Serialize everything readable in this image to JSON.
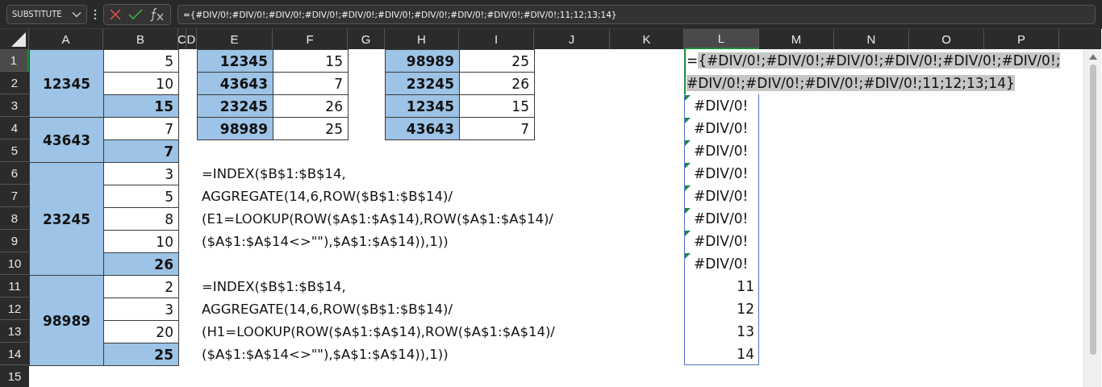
{
  "formula_bar": {
    "name_box": "SUBSTITUTE",
    "formula": "={#DIV/0!;#DIV/0!;#DIV/0!;#DIV/0!;#DIV/0!;#DIV/0!;#DIV/0!;#DIV/0!;#DIV/0!;#DIV/0!;11;12;13;14}"
  },
  "columns": [
    {
      "label": "A",
      "selected": false
    },
    {
      "label": "B",
      "selected": false
    },
    {
      "label": "C",
      "selected": false
    },
    {
      "label": "D",
      "selected": false
    },
    {
      "label": "E",
      "selected": false
    },
    {
      "label": "F",
      "selected": false
    },
    {
      "label": "G",
      "selected": false
    },
    {
      "label": "H",
      "selected": false
    },
    {
      "label": "I",
      "selected": false
    },
    {
      "label": "J",
      "selected": false
    },
    {
      "label": "K",
      "selected": false
    },
    {
      "label": "L",
      "selected": true
    },
    {
      "label": "M",
      "selected": false
    },
    {
      "label": "N",
      "selected": false
    },
    {
      "label": "O",
      "selected": false
    },
    {
      "label": "P",
      "selected": false
    }
  ],
  "rows": [
    {
      "label": "1",
      "selected": true
    },
    {
      "label": "2",
      "selected": false
    },
    {
      "label": "3",
      "selected": false
    },
    {
      "label": "4",
      "selected": false
    },
    {
      "label": "5",
      "selected": false
    },
    {
      "label": "6",
      "selected": false
    },
    {
      "label": "7",
      "selected": false
    },
    {
      "label": "8",
      "selected": false
    },
    {
      "label": "9",
      "selected": false
    },
    {
      "label": "10",
      "selected": false
    },
    {
      "label": "11",
      "selected": false
    },
    {
      "label": "12",
      "selected": false
    },
    {
      "label": "13",
      "selected": false
    },
    {
      "label": "14",
      "selected": false
    },
    {
      "label": "15",
      "selected": false
    }
  ],
  "groups": [
    {
      "label": "12345",
      "values": [
        {
          "value": "5",
          "total": false
        },
        {
          "value": "10",
          "total": false
        },
        {
          "value": "15",
          "total": true
        }
      ]
    },
    {
      "label": "43643",
      "values": [
        {
          "value": "7",
          "total": false
        },
        {
          "value": "7",
          "total": true
        }
      ]
    },
    {
      "label": "23245",
      "values": [
        {
          "value": "3",
          "total": false
        },
        {
          "value": "5",
          "total": false
        },
        {
          "value": "8",
          "total": false
        },
        {
          "value": "10",
          "total": false
        },
        {
          "value": "26",
          "total": true
        }
      ]
    },
    {
      "label": "98989",
      "values": [
        {
          "value": "2",
          "total": false
        },
        {
          "value": "3",
          "total": false
        },
        {
          "value": "20",
          "total": false
        },
        {
          "value": "25",
          "total": true
        }
      ]
    }
  ],
  "lookup_tables": [
    {
      "rows": [
        {
          "key": "12345",
          "value": "15"
        },
        {
          "key": "43643",
          "value": "7"
        },
        {
          "key": "23245",
          "value": "26"
        },
        {
          "key": "98989",
          "value": "25"
        }
      ]
    },
    {
      "rows": [
        {
          "key": "98989",
          "value": "25"
        },
        {
          "key": "23245",
          "value": "26"
        },
        {
          "key": "12345",
          "value": "15"
        },
        {
          "key": "43643",
          "value": "7"
        }
      ]
    }
  ],
  "formulas": [
    {
      "lines": [
        "=INDEX($B$1:$B$14,",
        "AGGREGATE(14,6,ROW($B$1:$B$14)/",
        "(E1=LOOKUP(ROW($A$1:$A$14),ROW($A$1:$A$14)/",
        "($A$1:$A$14<>\"\"),$A$1:$A$14)),1))"
      ]
    },
    {
      "lines": [
        "=INDEX($B$1:$B$14,",
        "AGGREGATE(14,6,ROW($B$1:$B$14)/",
        "(H1=LOOKUP(ROW($A$1:$A$14),ROW($A$1:$A$14)/",
        "($A$1:$A$14<>\"\"),$A$1:$A$14)),1))"
      ]
    }
  ],
  "array_preview": {
    "lines": [
      "={#DIV/0!;#DIV/0!;#DIV/0!;#DIV/0!;#DIV/0!;#DIV/0!;",
      "#DIV/0!;#DIV/0!;#DIV/0!;#DIV/0!;11;12;13;14}"
    ]
  },
  "results": [
    {
      "value": "#DIV/0!",
      "error": true
    },
    {
      "value": "#DIV/0!",
      "error": true
    },
    {
      "value": "#DIV/0!",
      "error": true
    },
    {
      "value": "#DIV/0!",
      "error": true
    },
    {
      "value": "#DIV/0!",
      "error": true
    },
    {
      "value": "#DIV/0!",
      "error": true
    },
    {
      "value": "#DIV/0!",
      "error": true
    },
    {
      "value": "#DIV/0!",
      "error": true
    },
    {
      "value": "11",
      "error": false
    },
    {
      "value": "12",
      "error": false
    },
    {
      "value": "13",
      "error": false
    },
    {
      "value": "14",
      "error": false
    }
  ]
}
